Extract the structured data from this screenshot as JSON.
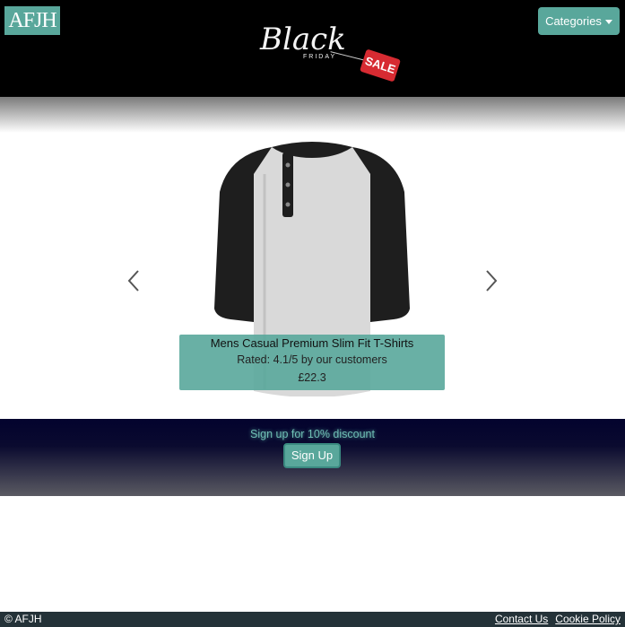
{
  "header": {
    "logo_text": "AFJH",
    "promo": {
      "word": "Black",
      "subword": "FRIDAY",
      "tag": "SALE"
    },
    "categories_label": "Categories"
  },
  "carousel": {
    "product_name": "Mens Casual Premium Slim Fit T-Shirts",
    "rating_text": "Rated: 4.1/5 by our customers",
    "price": "£22.3",
    "prev_icon": "chevron-left-icon",
    "next_icon": "chevron-right-icon"
  },
  "signup": {
    "prompt": "Sign up for 10% discount",
    "button_label": "Sign Up"
  },
  "footer": {
    "copyright": "© AFJH",
    "links": [
      "Contact Us",
      "Cookie Policy"
    ]
  },
  "colors": {
    "accent": "#59a79b",
    "header_bg": "#000000",
    "footer_bg": "#243238",
    "signup_bg_top": "#03032e"
  }
}
